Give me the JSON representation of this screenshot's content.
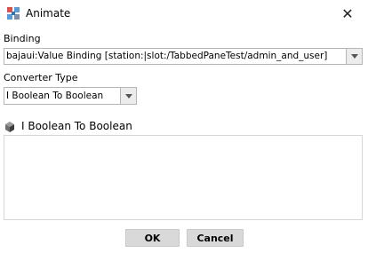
{
  "window": {
    "title": "Animate",
    "close_glyph": "✕"
  },
  "binding": {
    "label": "Binding",
    "value": "bajaui:Value Binding [station:|slot:/TabbedPaneTest/admin_and_user]"
  },
  "converter": {
    "label": "Converter Type",
    "value": "I Boolean To Boolean"
  },
  "panel": {
    "title": "I Boolean To Boolean",
    "icon": "cube-icon"
  },
  "buttons": {
    "ok": "OK",
    "cancel": "Cancel"
  },
  "colors": {
    "button_bg": "#d9d9d9",
    "field_border": "#b5b5b5",
    "dropdown_bg": "#ececec"
  }
}
